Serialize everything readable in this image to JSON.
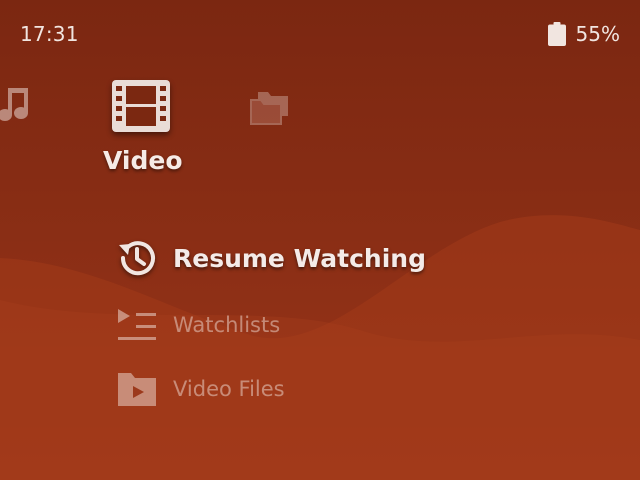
{
  "status_bar": {
    "time": "17:31",
    "battery_percent": "55%",
    "battery_icon": "battery-icon"
  },
  "categories": [
    {
      "name": "music",
      "icon": "music-note-icon"
    },
    {
      "name": "video",
      "icon": "film-icon",
      "label": "Video",
      "selected": true
    },
    {
      "name": "collections",
      "icon": "collections-icon"
    }
  ],
  "menu": {
    "items": [
      {
        "label": "Resume Watching",
        "icon": "history-icon",
        "focused": true
      },
      {
        "label": "Watchlists",
        "icon": "playlist-icon",
        "focused": false
      },
      {
        "label": "Video Files",
        "icon": "video-folder-icon",
        "focused": false
      }
    ]
  },
  "colors": {
    "background_top": "#7a2812",
    "background_bottom": "#a53a1c",
    "text": "#f3e6e1"
  }
}
